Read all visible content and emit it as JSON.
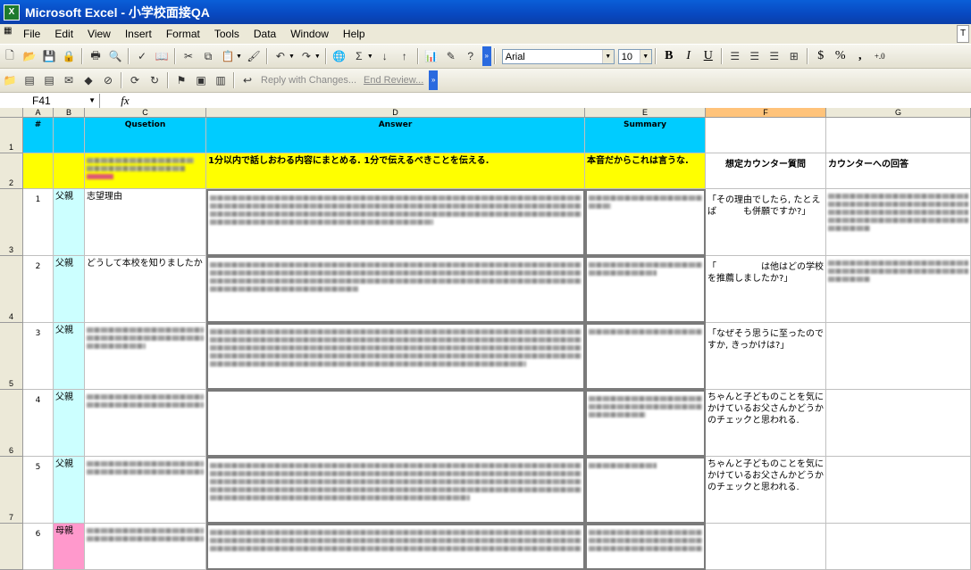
{
  "window": {
    "title": "Microsoft Excel - 小学校面接QA",
    "app_icon": "excel-icon"
  },
  "menu": {
    "items": [
      "File",
      "Edit",
      "View",
      "Insert",
      "Format",
      "Tools",
      "Data",
      "Window",
      "Help"
    ],
    "right_box": "T"
  },
  "format_toolbar": {
    "font": "Arial",
    "size": "10",
    "bold": "B",
    "italic": "I",
    "underline": "U",
    "currency": "$",
    "percent": "%",
    "comma": ",",
    "decimal": "+.0"
  },
  "review_toolbar": {
    "reply": "Reply with Changes...",
    "end_review": "End Review..."
  },
  "formula_bar": {
    "cell_ref": "F41",
    "fx": "fx",
    "content": ""
  },
  "columns": [
    "A",
    "B",
    "C",
    "D",
    "E",
    "F",
    "G"
  ],
  "selected_column": "F",
  "rows": [
    "1",
    "2",
    "3",
    "4",
    "5",
    "6",
    "7"
  ],
  "header_row": {
    "a": "#",
    "c": "Qusetion",
    "d": "Answer",
    "e": "Summary"
  },
  "row2": {
    "d": "1分以内で話しおわる内容にまとめる. 1分で伝えるべきことを伝える.",
    "e": "本音だからこれは言うな.",
    "f": "想定カウンター質問",
    "g": "カウンターへの回答"
  },
  "data_rows": [
    {
      "num": "1",
      "parent": "父親",
      "question": "志望理由",
      "counter": "「その理由でしたら, たとえば　　　も併願ですか?」",
      "parent_color": "#ccffff"
    },
    {
      "num": "2",
      "parent": "父親",
      "question": "どうして本校を知りましたか",
      "counter": "「　　　　　は他はどの学校を推薦しましたか?」",
      "parent_color": "#ccffff"
    },
    {
      "num": "3",
      "parent": "父親",
      "question": "",
      "counter": "「なぜそう思うに至ったのですか, きっかけは?」",
      "parent_color": "#ccffff"
    },
    {
      "num": "4",
      "parent": "父親",
      "question": "",
      "counter": "ちゃんと子どものことを気にかけているお父さんかどうかのチェックと思われる.",
      "parent_color": "#ccffff"
    },
    {
      "num": "5",
      "parent": "父親",
      "question": "",
      "counter": "ちゃんと子どものことを気にかけているお父さんかどうかのチェックと思われる.",
      "parent_color": "#ccffff"
    },
    {
      "num": "6",
      "parent": "母親",
      "question": "",
      "counter": "",
      "parent_color": "#ff99cc"
    }
  ],
  "colors": {
    "header_cyan": "#00ccff",
    "highlight_yellow": "#ffff00",
    "selected_col": "#ffc37a",
    "titlebar": "#0a5fd8"
  }
}
